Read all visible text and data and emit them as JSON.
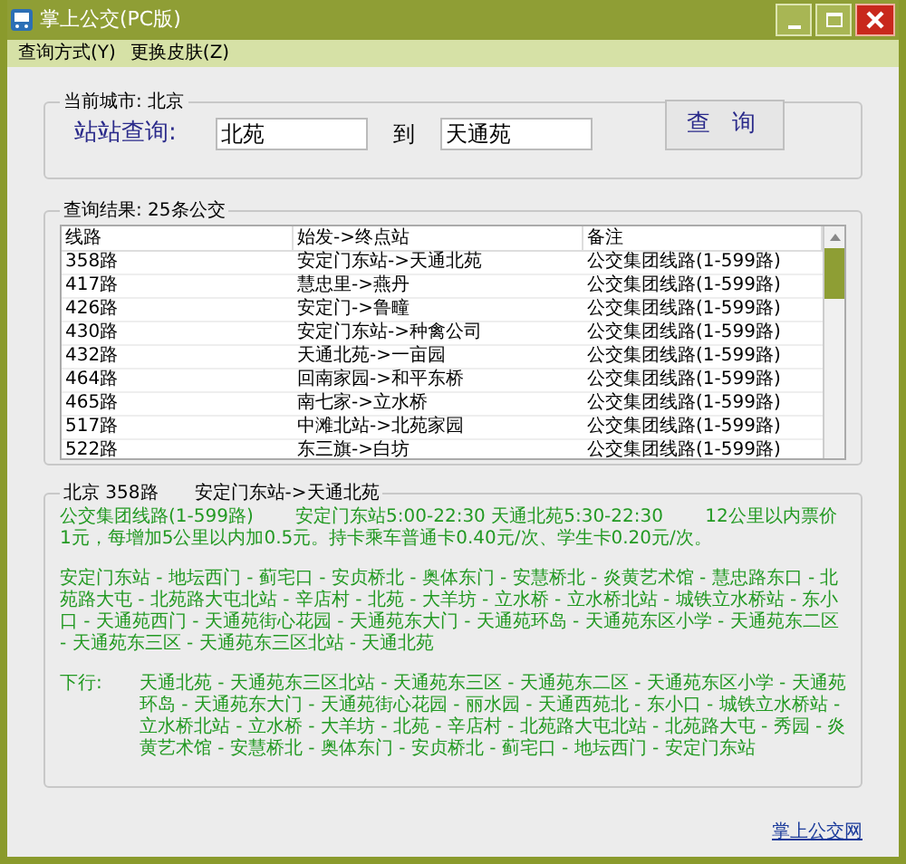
{
  "window": {
    "title": "掌上公交(PC版)"
  },
  "menu": [
    "查询方式(Y)",
    "更换皮肤(Z)"
  ],
  "search_group": {
    "title": "当前城市: 北京",
    "label": "站站查询:",
    "from": "北苑",
    "to_label": "到",
    "to": "天通苑",
    "button": "查 询"
  },
  "results": {
    "title": "查询结果: 25条公交",
    "columns": [
      "线路",
      "始发->终点站",
      "备注"
    ],
    "rows": [
      {
        "cells": [
          "358路",
          "安定门东站->天通北苑",
          "公交集团线路(1-599路)"
        ],
        "selected": false
      },
      {
        "cells": [
          "417路",
          "慧忠里->燕丹",
          "公交集团线路(1-599路)"
        ],
        "selected": false
      },
      {
        "cells": [
          "426路",
          "安定门->鲁疃",
          "公交集团线路(1-599路)"
        ],
        "selected": false
      },
      {
        "cells": [
          "430路",
          "安定门东站->种禽公司",
          "公交集团线路(1-599路)"
        ],
        "selected": false
      },
      {
        "cells": [
          "432路",
          "天通北苑->一亩园",
          "公交集团线路(1-599路)"
        ],
        "selected": false
      },
      {
        "cells": [
          "464路",
          "回南家园->和平东桥",
          "公交集团线路(1-599路)"
        ],
        "selected": false
      },
      {
        "cells": [
          "465路",
          "南七家->立水桥",
          "公交集团线路(1-599路)"
        ],
        "selected": false
      },
      {
        "cells": [
          "517路",
          "中滩北站->北苑家园",
          "公交集团线路(1-599路)"
        ],
        "selected": false
      },
      {
        "cells": [
          "522路",
          "东三旗->白坊",
          "公交集团线路(1-599路)"
        ],
        "selected": false
      }
    ]
  },
  "detail": {
    "title": "北京 358路",
    "route": "安定门东站->天通北苑",
    "info": "公交集团线路(1-599路)　　 安定门东站5:00-22:30 天通北苑5:30-22:30　　 12公里以内票价1元，每增加5公里以内加0.5元。持卡乘车普通卡0.40元/次、学生卡0.20元/次。",
    "up": "安定门东站 - 地坛西门 - 蓟宅口 - 安贞桥北 - 奥体东门 - 安慧桥北 - 炎黄艺术馆 - 慧忠路东口 - 北苑路大屯 - 北苑路大屯北站 - 辛店村 - 北苑 - 大羊坊 - 立水桥 - 立水桥北站 - 城铁立水桥站 - 东小口 - 天通苑西门 - 天通苑街心花园 - 天通苑东大门 - 天通苑环岛 - 天通苑东区小学 - 天通苑东二区 - 天通苑东三区 - 天通苑东三区北站 - 天通北苑",
    "down_label": "下行:",
    "down": "天通北苑 - 天通苑东三区北站 - 天通苑东三区 - 天通苑东二区 - 天通苑东区小学 - 天通苑环岛 - 天通苑东大门 - 天通苑街心花园 - 丽水园 - 天通西苑北 - 东小口 - 城铁立水桥站 - 立水桥北站 - 立水桥 - 大羊坊 - 北苑 - 辛店村 - 北苑路大屯北站 - 北苑路大屯 - 秀园 - 炎黄艺术馆 - 安慧桥北 - 奥体东门 - 安贞桥北 - 蓟宅口 - 地坛西门 - 安定门东站"
  },
  "footer_link": "掌上公交网"
}
